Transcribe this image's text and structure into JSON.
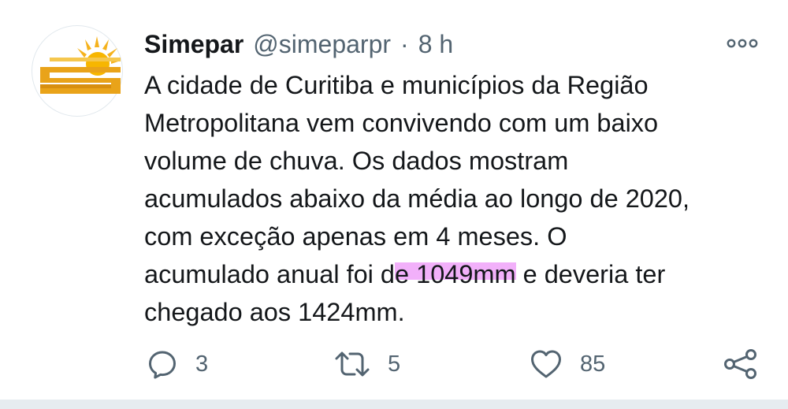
{
  "tweet": {
    "avatar_icon": "simepar-logo",
    "display_name": "Simepar",
    "handle": "@simeparpr",
    "separator": "·",
    "time": "8 h",
    "text_lines": [
      "A cidade de Curitiba e municípios da Região",
      "Metropolitana vem convivendo com um baixo",
      "volume de chuva. Os dados mostram",
      "acumulados abaixo da média ao longo de 2020,",
      "com exceção apenas em 4 meses. O"
    ],
    "line6_before": "acumulado anual foi d",
    "line6_highlight": "e 1049mm",
    "line6_after": " e deveria ter",
    "line7": "chegado aos 1424mm.",
    "highlight_color": "#ee96f8"
  },
  "actions": {
    "reply_count": "3",
    "retweet_count": "5",
    "like_count": "85",
    "icons": [
      "reply-icon",
      "retweet-icon",
      "like-icon",
      "share-icon"
    ],
    "icon_color": "#536471"
  }
}
